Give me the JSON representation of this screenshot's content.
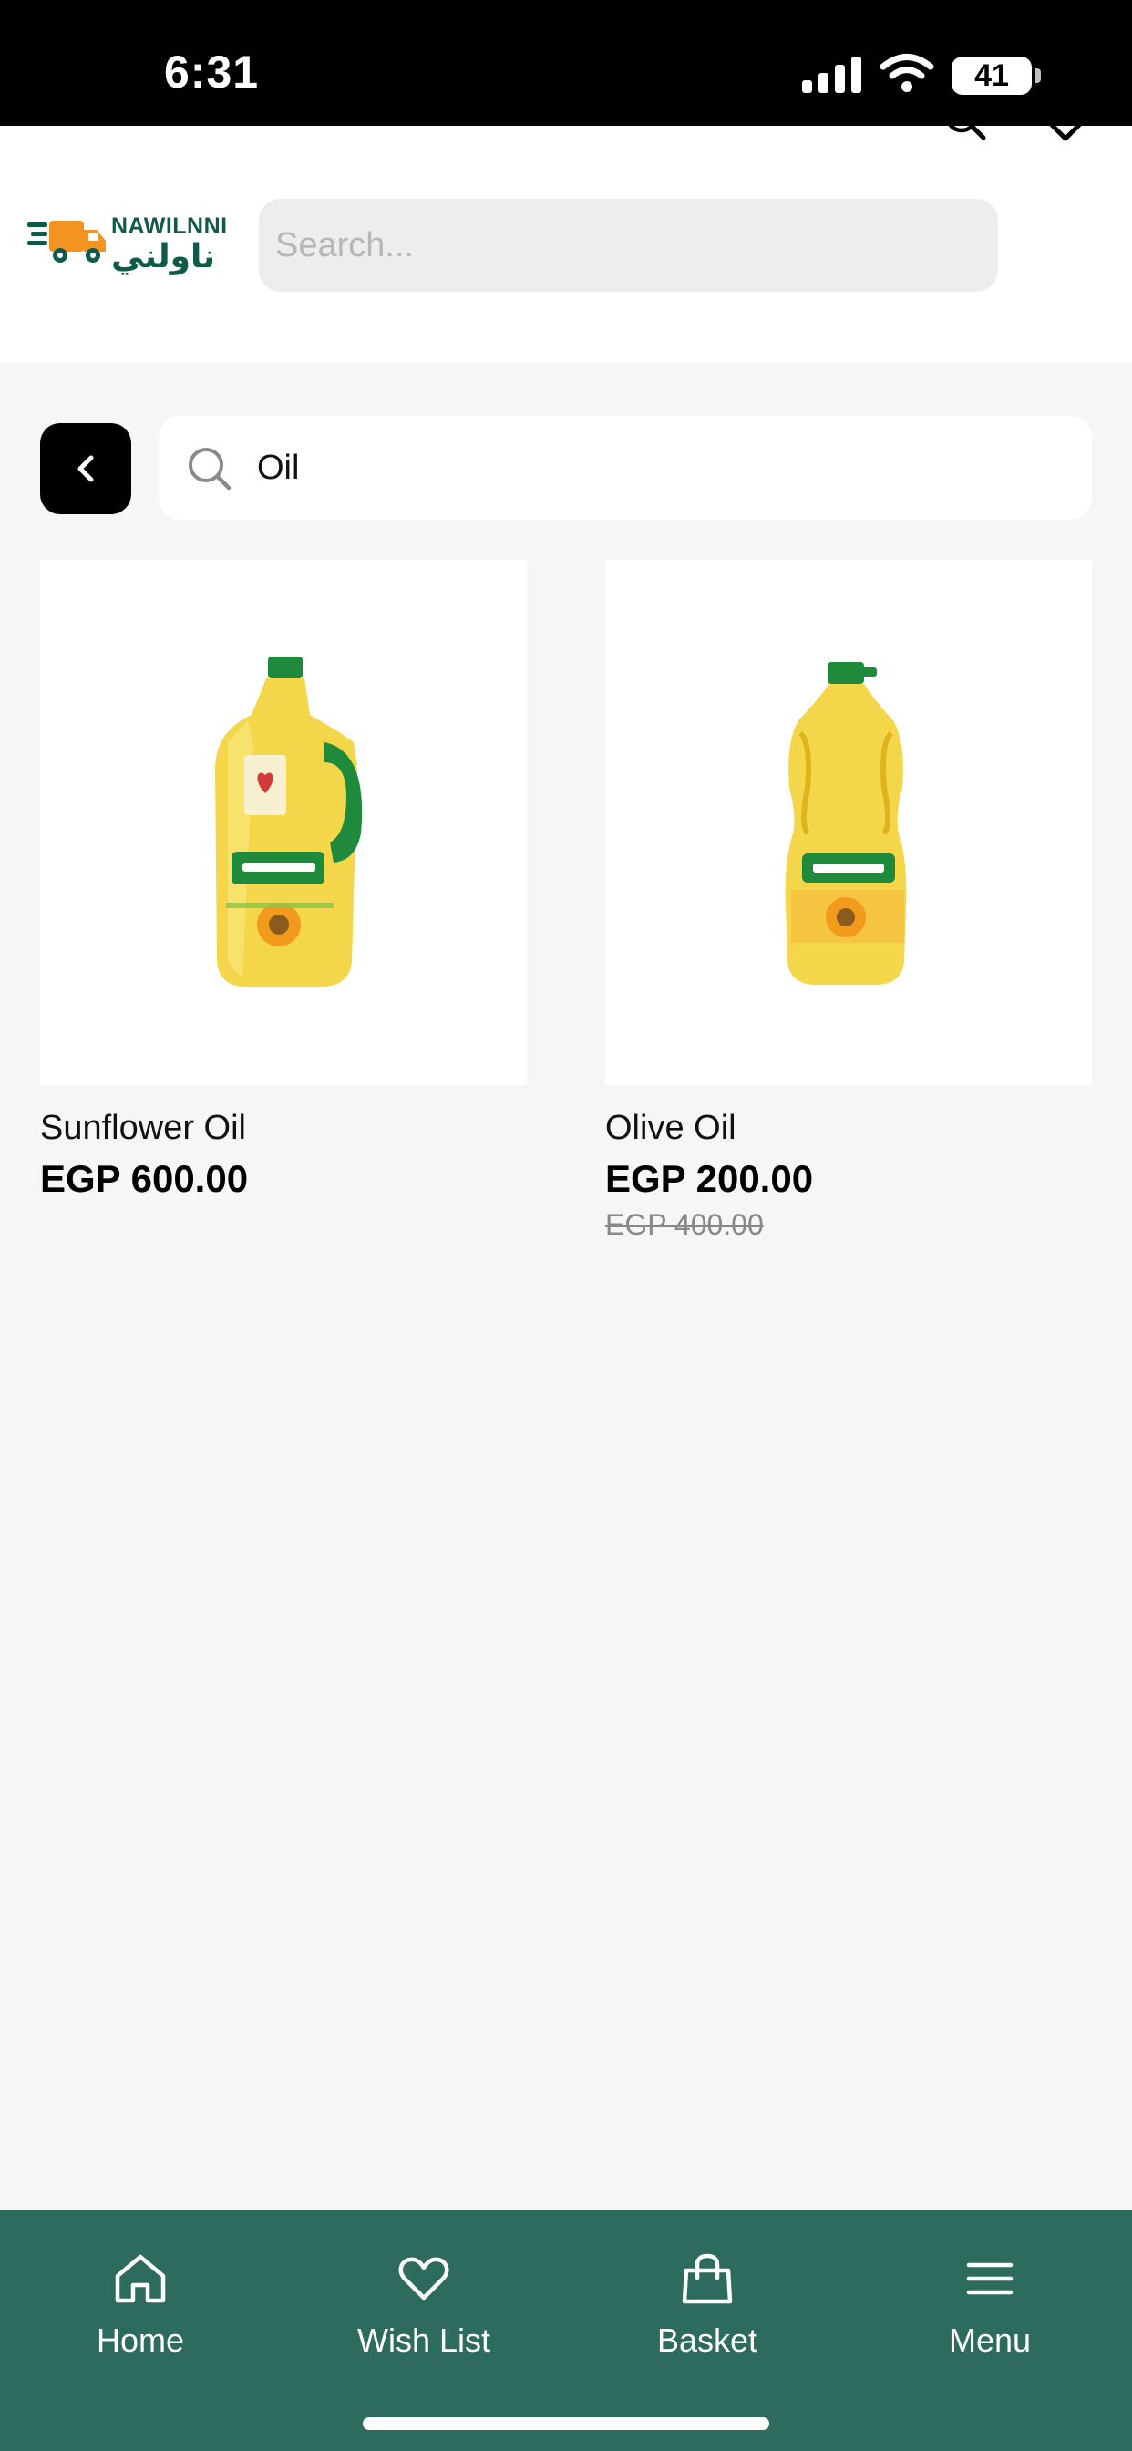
{
  "status_bar": {
    "time": "6:31",
    "battery": "41",
    "icons": [
      "signal-icon",
      "wifi-icon",
      "battery-icon"
    ]
  },
  "header": {
    "logo_en": "NAWILNNI",
    "logo_ar": "ناولني",
    "search_placeholder": "Search...",
    "icons": [
      "search-icon",
      "heart-icon"
    ]
  },
  "results": {
    "query": "Oil",
    "icons": [
      "back-chevron-icon",
      "search-icon"
    ]
  },
  "products": [
    {
      "name": "Sunflower Oil",
      "price": "EGP 600.00",
      "old_price": "",
      "image": "oil-bottle-with-handle"
    },
    {
      "name": "Olive Oil",
      "price": "EGP 200.00",
      "old_price": "EGP 400.00",
      "image": "oil-bottle"
    }
  ],
  "bottom_nav": {
    "items": [
      {
        "label": "Home",
        "icon": "home-icon"
      },
      {
        "label": "Wish List",
        "icon": "heart-icon"
      },
      {
        "label": "Basket",
        "icon": "basket-icon"
      },
      {
        "label": "Menu",
        "icon": "menu-icon"
      }
    ]
  },
  "colors": {
    "brand_green": "#2c6b5e",
    "logo_green": "#0f5a4a",
    "truck_orange": "#f39422",
    "background": "#f6f6f6"
  }
}
